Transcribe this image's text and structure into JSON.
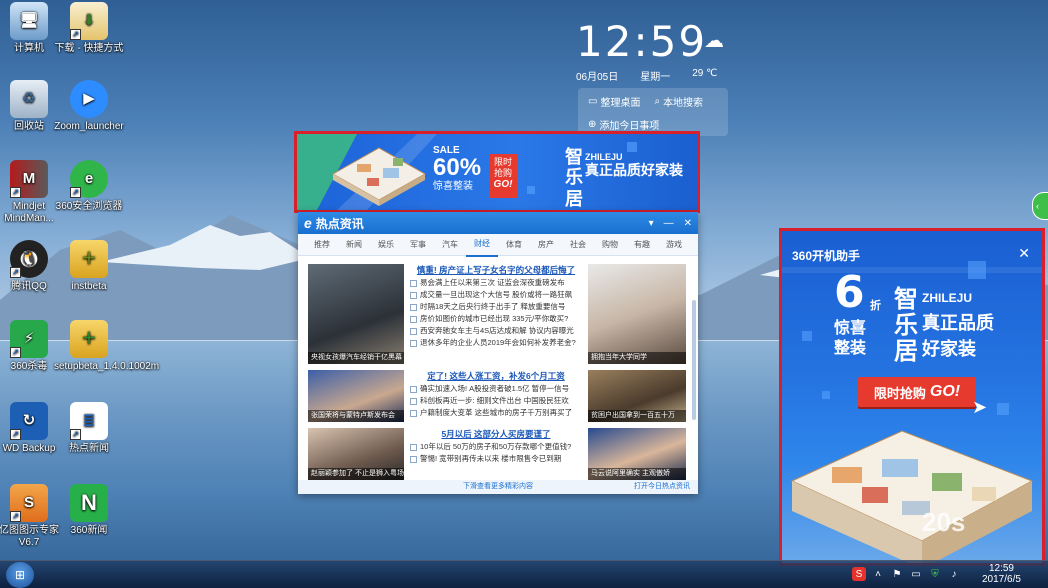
{
  "desktop": {
    "icons": [
      {
        "label": "计算机",
        "icon": "computer-icon"
      },
      {
        "label": "下载 - 快捷方式",
        "icon": "download-folder-icon"
      },
      {
        "label": "回收站",
        "icon": "recycle-bin-icon"
      },
      {
        "label": "Zoom_launcher",
        "icon": "zoom-icon"
      },
      {
        "label": "Mindjet MindMan...",
        "icon": "mindjet-icon"
      },
      {
        "label": "360安全浏览器",
        "icon": "360-browser-icon"
      },
      {
        "label": "腾讯QQ",
        "icon": "qq-penguin-icon"
      },
      {
        "label": "instbeta",
        "icon": "package-icon"
      },
      {
        "label": "360杀毒",
        "icon": "360-antivirus-icon"
      },
      {
        "label": "setupbeta_1.4.0.1002m",
        "icon": "setup-package-icon"
      },
      {
        "label": "WD Backup",
        "icon": "wd-backup-icon"
      },
      {
        "label": "热点新闻",
        "icon": "hot-news-icon"
      },
      {
        "label": "亿图图示专家 V6.7",
        "icon": "edraw-icon"
      },
      {
        "label": "360新闻",
        "icon": "360-news-icon"
      }
    ]
  },
  "clock_widget": {
    "time": "12:59",
    "date": "06月05日",
    "weekday": "星期一",
    "temperature": "29 ℃",
    "action1": "整理桌面",
    "action2": "本地搜索",
    "action3": "添加今日事项"
  },
  "top_ad": {
    "sale": "SALE",
    "percent": "60%",
    "surprise": "惊喜整装",
    "limit_1": "限时",
    "limit_2": "抢购",
    "go": "GO!",
    "brand_1": "智",
    "brand_en": "ZHILEJU",
    "brand_2": "乐",
    "brand_3": "居",
    "slogan": "真正品质好家装"
  },
  "news_window": {
    "title": "热点资讯",
    "tabs": [
      "推荐",
      "新闻",
      "娱乐",
      "军事",
      "汽车",
      "财经",
      "体育",
      "房产",
      "社会",
      "购物",
      "有趣",
      "游戏"
    ],
    "active_tab": "财经",
    "photo_captions": [
      "央视女孩爆汽车经销干亿黑幕",
      "拥抱当年大学同学",
      "张国荣将与蒙特卢斯发布会",
      "贫困户出国拿到一百五十万",
      "赵丽颖参加了 不止是狮入粤场一年",
      "马云说阿里确实 主观傲娇"
    ],
    "sections": [
      {
        "headline": "慎重! 房产证上写子女名字的父母都后悔了",
        "items": [
          "易会满上任以来第三次 证监会深夜重磅发布",
          "成交量一旦出现这个大信号 股价或将一路狂飙",
          "时隔18天之后央行终于出手了 释放重要信号",
          "房价如图价的城市已经出现 335元/平你敢买?",
          "西安奔驰女车主与4S店达成和解 协议内容曝光",
          "退休多年的企业人员2019年会如何补发养老金?"
        ]
      },
      {
        "headline": "定了! 这些人涨工资，补发6个月工资",
        "items": [
          "确实加速入场! A股投资者破1.5亿 暂停一信号",
          "科创板再近一步: 细则文件出台 中国股民狂欢",
          "户籍制度大变革 这些城市的房子千万别再买了"
        ]
      },
      {
        "headline": "5月以后 这部分人买房要谨了",
        "items": [
          "10年以后 50万的房子和50万存款哪个更值钱?",
          "警惕! 宽带别再传未以来 楼市限售令已到期"
        ]
      }
    ],
    "footer": "下滑查看更多精彩内容",
    "footer_link": "打开今日热点资讯"
  },
  "side_ad": {
    "header": "360开机助手",
    "discount": "6",
    "discount_unit": "折",
    "surprise_1": "惊喜",
    "surprise_2": "整装",
    "brand_1": "智",
    "brand_en": "ZHILEJU",
    "slogan_1": "真正品质",
    "brand_2": "乐",
    "brand_3": "居",
    "slogan_2": "好家装",
    "buy_label": "限时抢购",
    "go": "GO!",
    "countdown": "20s"
  },
  "taskbar": {
    "clock_time": "12:59",
    "clock_date": "2017/6/5",
    "tray_icons": [
      "sogou-input-icon",
      "chevron-up-icon",
      "flag-icon",
      "monitor-icon",
      "shield-icon",
      "speaker-icon"
    ]
  },
  "colors": {
    "ad_border": "#d9202a",
    "ad_blue": "#1c63d8",
    "accent_red": "#e63a2e",
    "news_blue": "#1a6fd0"
  }
}
